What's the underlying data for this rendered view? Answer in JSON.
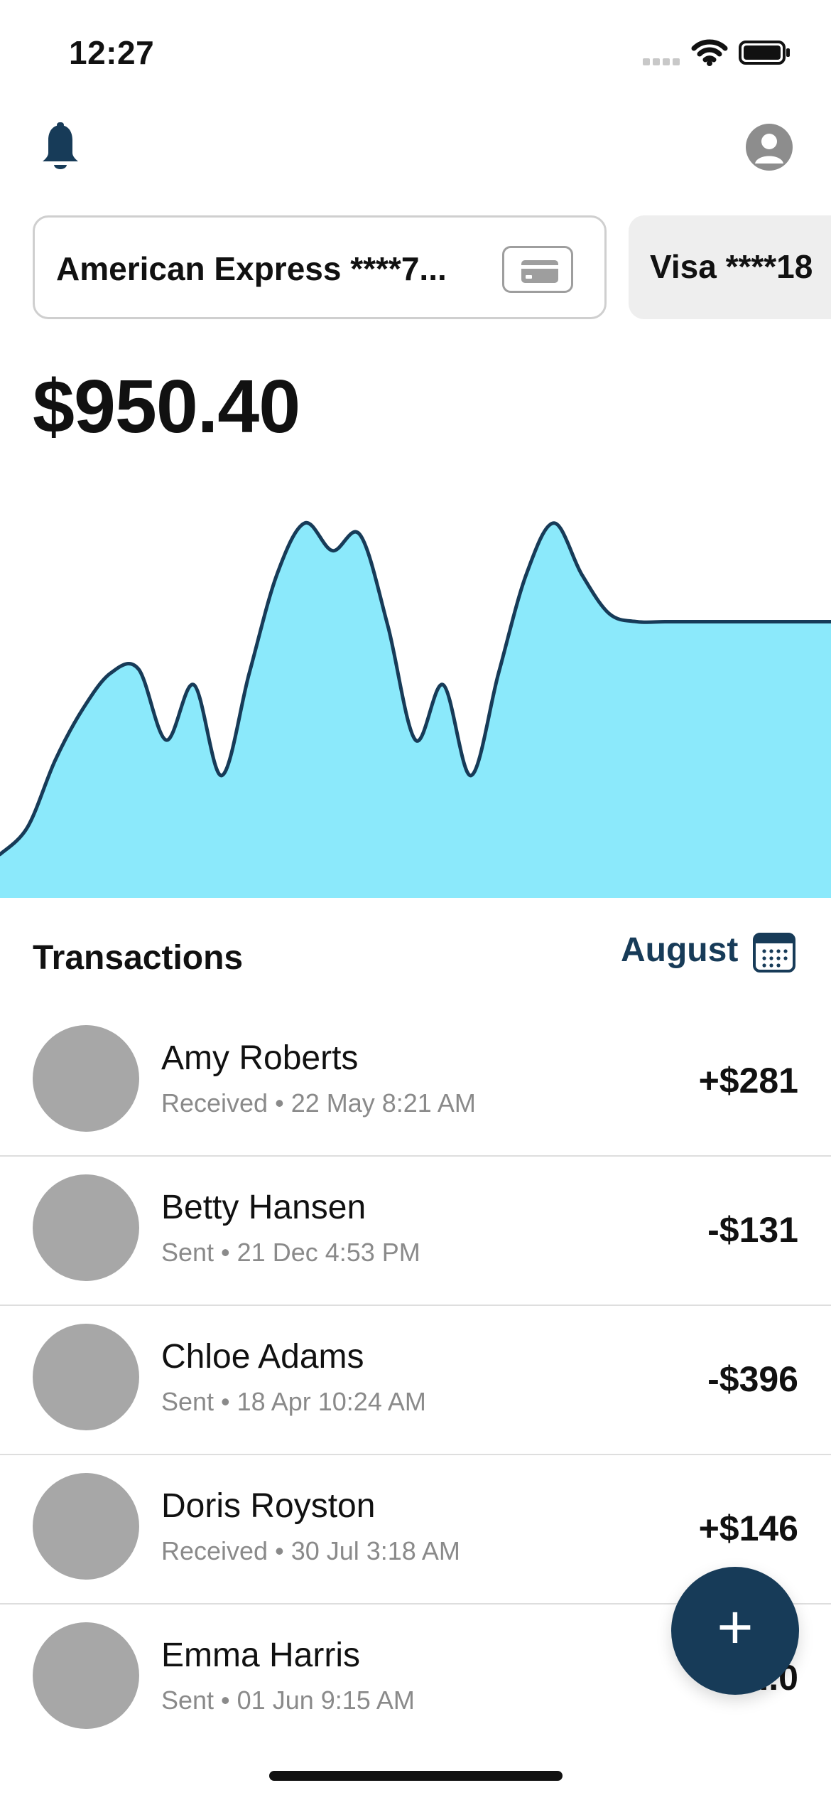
{
  "status_bar": {
    "time": "12:27"
  },
  "header": {
    "notification_icon": "bell-icon",
    "profile_icon": "person-icon"
  },
  "cards": [
    {
      "label": "American Express ****7...",
      "selected": true,
      "icon": "credit-card-icon"
    },
    {
      "label": "Visa ****18",
      "selected": false
    }
  ],
  "balance": "$950.40",
  "chart_data": {
    "type": "area",
    "title": "",
    "xlabel": "",
    "ylabel": "",
    "grid": false,
    "legend": "none",
    "colors": {
      "fill": "#8be9fb",
      "line": "#173b58"
    },
    "x": [
      0,
      1,
      2,
      3,
      4,
      5,
      6,
      7,
      8,
      9,
      10,
      11,
      12,
      13,
      14,
      15,
      16,
      17,
      18,
      19,
      20,
      21,
      22,
      23,
      24,
      25,
      26,
      27,
      28,
      29,
      30
    ],
    "values": [
      0.11,
      0.18,
      0.35,
      0.48,
      0.57,
      0.58,
      0.4,
      0.54,
      0.31,
      0.57,
      0.82,
      0.95,
      0.88,
      0.92,
      0.69,
      0.4,
      0.54,
      0.31,
      0.57,
      0.82,
      0.95,
      0.82,
      0.72,
      0.7,
      0.7,
      0.7,
      0.7,
      0.7,
      0.7,
      0.7,
      0.7
    ],
    "ylim": [
      0,
      1
    ]
  },
  "transactions": {
    "title": "Transactions",
    "month": "August",
    "calendar_icon": "calendar-icon",
    "items": [
      {
        "name": "Amy Roberts",
        "type": "Received",
        "date": "22 May 8:21 AM",
        "meta": "Received • 22 May 8:21 AM",
        "amount": "+$281"
      },
      {
        "name": "Betty Hansen",
        "type": "Sent",
        "date": "21 Dec 4:53 PM",
        "meta": "Sent • 21 Dec 4:53 PM",
        "amount": "-$131"
      },
      {
        "name": "Chloe Adams",
        "type": "Sent",
        "date": "18 Apr 10:24 AM",
        "meta": "Sent • 18 Apr 10:24 AM",
        "amount": "-$396"
      },
      {
        "name": "Doris Royston",
        "type": "Received",
        "date": "30 Jul 3:18 AM",
        "meta": "Received • 30 Jul 3:18 AM",
        "amount": "+$146"
      },
      {
        "name": "Emma Harris",
        "type": "Sent",
        "date": "01 Jun 9:15 AM",
        "meta": "Sent • 01 Jun 9:15 AM",
        "amount": "-$...0"
      }
    ]
  },
  "fab": {
    "label": "+",
    "icon": "plus-icon"
  }
}
